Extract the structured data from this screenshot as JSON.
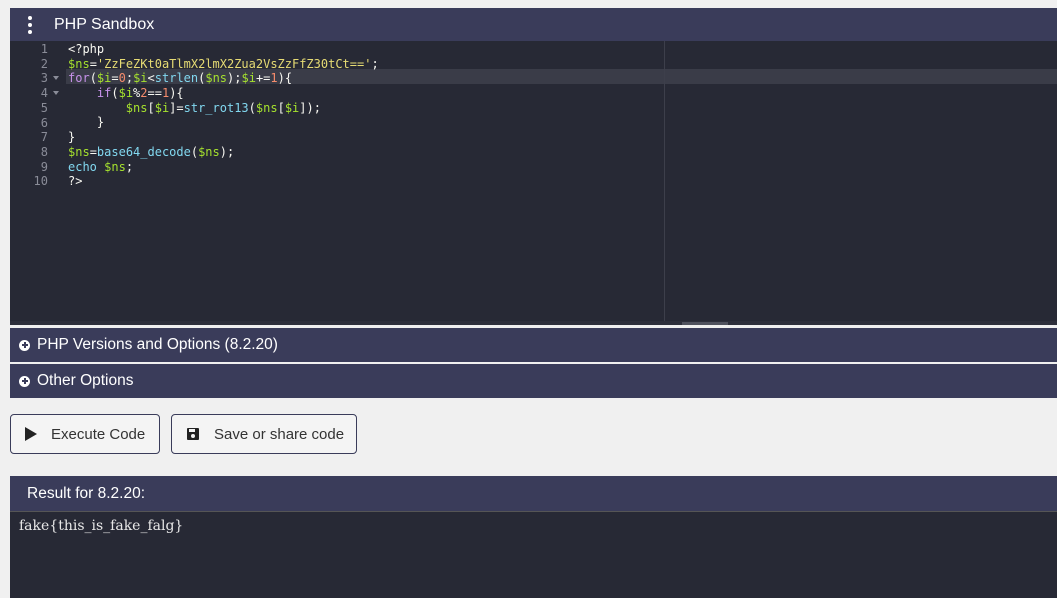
{
  "header": {
    "title": "PHP Sandbox",
    "menu_icon": "kebab-menu-icon"
  },
  "editor": {
    "line_numbers": [
      "1",
      "2",
      "3",
      "4",
      "5",
      "6",
      "7",
      "8",
      "9",
      "10"
    ],
    "lines": [
      [
        {
          "t": "txt",
          "v": "<?php"
        }
      ],
      [
        {
          "t": "var",
          "v": "$ns"
        },
        {
          "t": "op",
          "v": "="
        },
        {
          "t": "str",
          "v": "'ZzFeZKt0aTlmX2lmX2Zua2VsZzFfZ30tCt=='"
        },
        {
          "t": "op",
          "v": ";"
        }
      ],
      [
        {
          "t": "kw",
          "v": "for"
        },
        {
          "t": "op",
          "v": "("
        },
        {
          "t": "var",
          "v": "$i"
        },
        {
          "t": "op",
          "v": "="
        },
        {
          "t": "num",
          "v": "0"
        },
        {
          "t": "op",
          "v": ";"
        },
        {
          "t": "var",
          "v": "$i"
        },
        {
          "t": "op",
          "v": "<"
        },
        {
          "t": "fn",
          "v": "strlen"
        },
        {
          "t": "op",
          "v": "("
        },
        {
          "t": "var",
          "v": "$ns"
        },
        {
          "t": "op",
          "v": ");"
        },
        {
          "t": "var",
          "v": "$i"
        },
        {
          "t": "op",
          "v": "+="
        },
        {
          "t": "num",
          "v": "1"
        },
        {
          "t": "op",
          "v": "){"
        }
      ],
      [
        {
          "t": "txt",
          "v": "    "
        },
        {
          "t": "kw",
          "v": "if"
        },
        {
          "t": "op",
          "v": "("
        },
        {
          "t": "var",
          "v": "$i"
        },
        {
          "t": "op",
          "v": "%"
        },
        {
          "t": "num",
          "v": "2"
        },
        {
          "t": "op",
          "v": "=="
        },
        {
          "t": "num",
          "v": "1"
        },
        {
          "t": "op",
          "v": "){"
        }
      ],
      [
        {
          "t": "txt",
          "v": "        "
        },
        {
          "t": "var",
          "v": "$ns"
        },
        {
          "t": "op",
          "v": "["
        },
        {
          "t": "var",
          "v": "$i"
        },
        {
          "t": "op",
          "v": "]="
        },
        {
          "t": "fn",
          "v": "str_rot13"
        },
        {
          "t": "op",
          "v": "("
        },
        {
          "t": "var",
          "v": "$ns"
        },
        {
          "t": "op",
          "v": "["
        },
        {
          "t": "var",
          "v": "$i"
        },
        {
          "t": "op",
          "v": "]);"
        }
      ],
      [
        {
          "t": "txt",
          "v": "    }"
        }
      ],
      [
        {
          "t": "txt",
          "v": "}"
        }
      ],
      [
        {
          "t": "var",
          "v": "$ns"
        },
        {
          "t": "op",
          "v": "="
        },
        {
          "t": "fn",
          "v": "base64_decode"
        },
        {
          "t": "op",
          "v": "("
        },
        {
          "t": "var",
          "v": "$ns"
        },
        {
          "t": "op",
          "v": ");"
        }
      ],
      [
        {
          "t": "fn",
          "v": "echo"
        },
        {
          "t": "txt",
          "v": " "
        },
        {
          "t": "var",
          "v": "$ns"
        },
        {
          "t": "op",
          "v": ";"
        }
      ],
      [
        {
          "t": "txt",
          "v": "?>"
        }
      ]
    ],
    "fold_lines": [
      3,
      4
    ],
    "active_line": 3
  },
  "sections": {
    "versions_label": "PHP Versions and Options (8.2.20)",
    "other_label": "Other Options",
    "icon": "plus-circle-icon"
  },
  "buttons": {
    "execute_label": "Execute Code",
    "execute_icon": "play-icon",
    "save_label": "Save or share code",
    "save_icon": "floppy-disk-icon"
  },
  "result": {
    "title": "Result for 8.2.20:",
    "output": "fake{this_is_fake_falg}"
  },
  "colors": {
    "bar": "#3a3c5a",
    "editor_bg": "#272935",
    "page_bg": "#f0f0f0"
  }
}
